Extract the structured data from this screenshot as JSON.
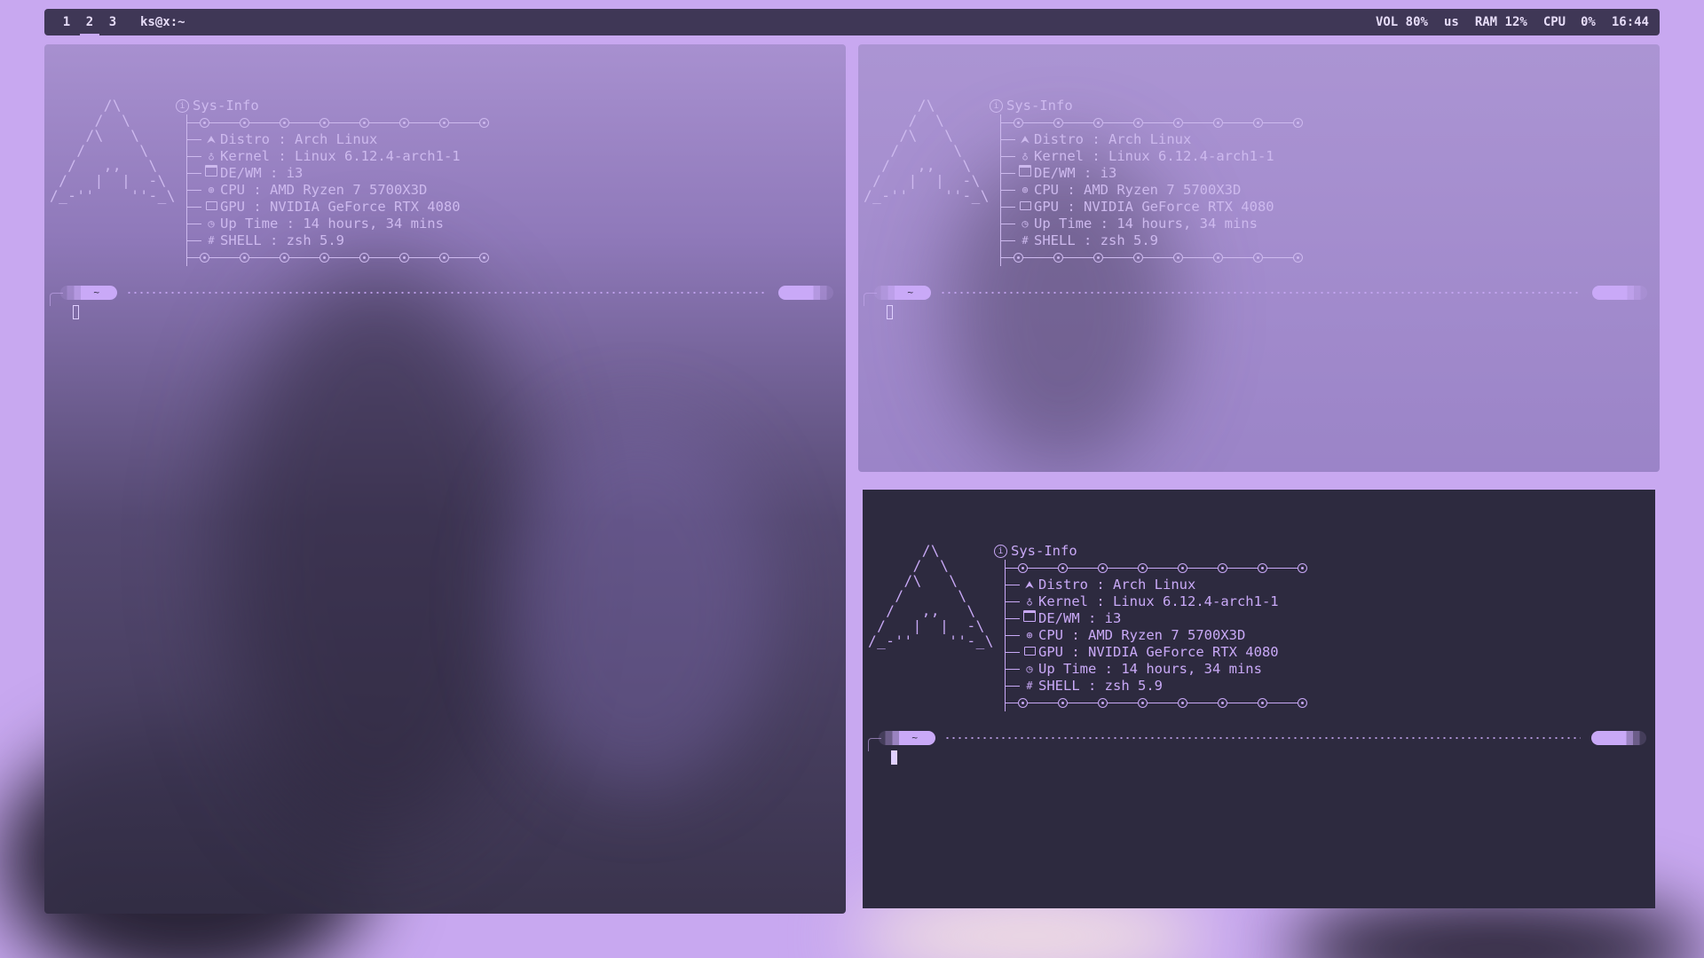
{
  "topbar": {
    "workspaces": [
      "1",
      "2",
      "3"
    ],
    "active_workspace": "2",
    "window_title": "ks@x:~",
    "status": {
      "vol": "VOL 80%",
      "layout": "us",
      "ram": "RAM 12%",
      "cpu": "CPU  0%",
      "time": "16:44"
    }
  },
  "fetch": {
    "ascii_logo": "      /\\\n     /  \\\n    /\\   \\\n   /      \\\n  /   ,,   \\\n /   |  |  -\\\n/_-''    ''-_\\",
    "header": "Sys-Info",
    "rows": [
      {
        "icon": "arch-icon",
        "glyph": "⮝",
        "label": "Distro",
        "value": "Arch Linux"
      },
      {
        "icon": "linux-icon",
        "glyph": "♁",
        "label": "Kernel",
        "value": "Linux 6.12.4-arch1-1"
      },
      {
        "icon": "window-icon",
        "glyph": "",
        "label": "DE/WM",
        "value": "i3"
      },
      {
        "icon": "cpu-icon",
        "glyph": "⊕",
        "label": "CPU",
        "value": "AMD Ryzen 7 5700X3D"
      },
      {
        "icon": "monitor-icon",
        "glyph": "",
        "label": "GPU",
        "value": "NVIDIA GeForce RTX 4080"
      },
      {
        "icon": "clock-icon",
        "glyph": "◷",
        "label": "Up Time",
        "value": "14 hours, 34 mins"
      },
      {
        "icon": "hash-icon",
        "glyph": "#",
        "label": "SHELL",
        "value": "zsh 5.9"
      }
    ],
    "prompt_dir": "~"
  },
  "colors": {
    "accent": "#c9a9f7",
    "bar_bg": "#3f3756",
    "term_dark": "#2d2a3f",
    "wallpaper": "#c8a8f0"
  }
}
